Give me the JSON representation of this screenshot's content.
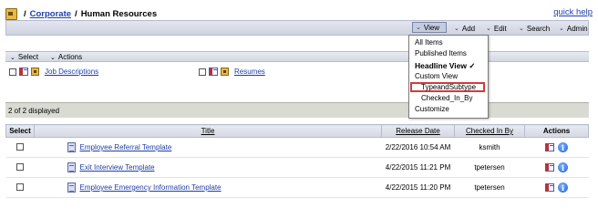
{
  "breadcrumb": {
    "root": "Corporate",
    "current": "Human Resources"
  },
  "header": {
    "quick_help": "quick help"
  },
  "toolbar": {
    "view": "View",
    "add": "Add",
    "edit": "Edit",
    "search": "Search",
    "admin": "Admin"
  },
  "section_bar": {
    "select": "Select",
    "actions": "Actions"
  },
  "content_items": [
    {
      "label": "Job Descriptions"
    },
    {
      "label": "Resumes"
    }
  ],
  "status": {
    "count_text": "2 of 2 displayed"
  },
  "table": {
    "headers": {
      "select": "Select",
      "title": "Title",
      "release_date": "Release Date",
      "checked_in_by": "Checked In By",
      "actions": "Actions"
    },
    "rows": [
      {
        "title": "Employee Referral Template",
        "release_date": "2/22/2016 10:54 AM",
        "checked_in_by": "ksmith"
      },
      {
        "title": "Exit Interview Template",
        "release_date": "4/22/2015 11:21 PM",
        "checked_in_by": "tpetersen"
      },
      {
        "title": "Employee Emergency Information Template",
        "release_date": "4/22/2015 11:20 PM",
        "checked_in_by": "tpetersen"
      }
    ]
  },
  "view_menu": {
    "items": [
      "All Items",
      "Published Items",
      "Headline View ✓",
      "Custom View",
      "TypeandSubtype",
      "Checked_In_By",
      "Customize"
    ],
    "active_index": 2,
    "highlighted_index": 4,
    "highlight_color": "#d23b3b"
  }
}
